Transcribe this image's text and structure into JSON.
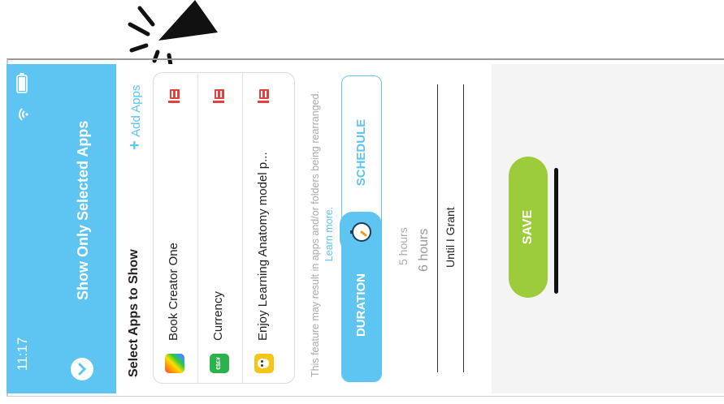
{
  "status": {
    "time": "11:17"
  },
  "header": {
    "title": "Show Only Selected Apps"
  },
  "section": {
    "title": "Select Apps to Show",
    "add_label": "Add Apps"
  },
  "apps": [
    {
      "name": "Book Creator One",
      "icon": "book-creator-icon"
    },
    {
      "name": "Currency",
      "icon": "currency-icon"
    },
    {
      "name": "Enjoy Learning Anatomy model p...",
      "icon": "anatomy-icon"
    }
  ],
  "notice": {
    "text": "This feature may result in apps and/or folders being rearranged.",
    "link": "Learn more."
  },
  "tabs": {
    "duration": "DURATION",
    "schedule": "SCHEDULE"
  },
  "picker": {
    "options": [
      "5 hours",
      "6 hours",
      "Until I Grant"
    ],
    "selected": "Until I Grant"
  },
  "footer": {
    "save_label": "SAVE"
  },
  "colors": {
    "accent": "#5ec4f2",
    "save": "#9ccb3b",
    "delete": "#e0433d"
  }
}
